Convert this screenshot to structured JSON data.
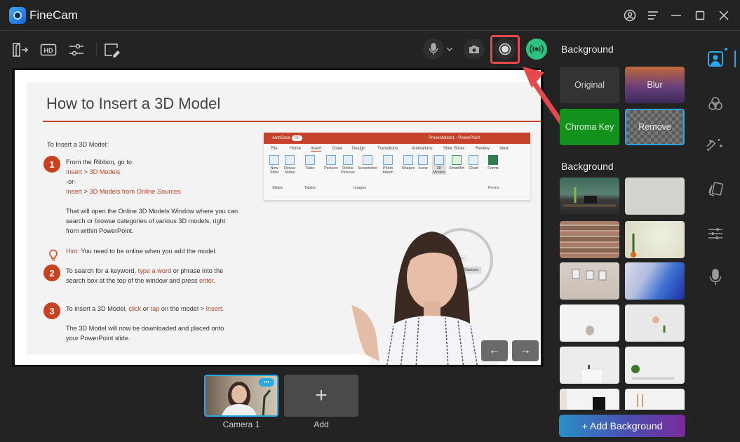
{
  "app": {
    "title": "FineCam"
  },
  "window_controls": [
    "account-icon",
    "menu-icon",
    "minimize-icon",
    "maximize-icon",
    "close-icon"
  ],
  "toolbar": {
    "left_tools": [
      "exit-icon",
      "hd-icon",
      "adjust-icon",
      "annotate-icon"
    ],
    "right_tools": [
      "microphone-icon",
      "chevron-down-icon",
      "camera-snapshot-icon",
      "record-icon",
      "live-broadcast-icon"
    ],
    "live_color": "#2ec27e",
    "highlight_color": "#e5484d"
  },
  "slide": {
    "title": "How to Insert a 3D Model",
    "intro": "To Insert a 3D Model:",
    "steps": [
      {
        "num": "1",
        "lines": [
          "From the Ribbon, go to"
        ],
        "path1": {
          "a": "Insert",
          "sep": " > ",
          "b": "3D Models"
        },
        "or": "-or-",
        "path2": {
          "a": "Insert",
          "sep": " > ",
          "b": "3D Models from Online Sources"
        }
      },
      {
        "num": "2",
        "pre": "To search for a keyword, ",
        "acc1": "type a word",
        "mid": " or phrase into the",
        "line2_pre": "search box at the top of the window and press ",
        "acc2": "enter",
        "end": "."
      },
      {
        "num": "3",
        "pre": "To insert a 3D Model, ",
        "acc1": "click",
        "mid1": " or ",
        "acc2": "tap",
        "mid2": " on the model > ",
        "acc3": "Insert",
        "end": "."
      }
    ],
    "para1": [
      "That will open the Online 3D Models Window where you can",
      "search or browse categories of various 3D models, right",
      "from within PowerPoint."
    ],
    "hint_label": "Hint:",
    "hint_text": " You need to be online when you add the model.",
    "para3": [
      "The 3D Model will now be downloaded and placed onto",
      "your PowerPoint slide."
    ],
    "ribbon": {
      "autosave": "AutoSave",
      "toggle": "On",
      "doc_title": "Presentation1 - PowerPoint",
      "tabs": [
        "File",
        "Home",
        "Insert",
        "Draw",
        "Design",
        "Transitions",
        "Animations",
        "Slide Show",
        "Review",
        "View"
      ],
      "items": [
        "New Slide",
        "Reuse Slides",
        "Table",
        "Pictures",
        "Online Pictures",
        "Screenshot",
        "Photo Album",
        "Shapes",
        "Icons",
        "3D Models",
        "SmartArt",
        "Chart",
        "Forms"
      ],
      "groups": [
        "Slides",
        "Tables",
        "Images",
        "Forms"
      ],
      "menu": [
        "From a File...",
        "From Online Sources"
      ]
    }
  },
  "nav": {
    "prev": "←",
    "next": "→"
  },
  "scenes": [
    {
      "label": "Camera 1",
      "more": "•••"
    }
  ],
  "add_scene": {
    "icon": "+",
    "label": "Add"
  },
  "right_panel": {
    "mode_heading": "Background",
    "modes": [
      {
        "label": "Original",
        "active": false
      },
      {
        "label": "Blur",
        "active": false
      },
      {
        "label": "Chroma Key",
        "active": false
      },
      {
        "label": "Remove",
        "active": true
      }
    ],
    "gallery_heading": "Background",
    "gallery": [
      {
        "name": "office-window-plant"
      },
      {
        "name": "white-plaster-wall"
      },
      {
        "name": "brick-wall"
      },
      {
        "name": "cream-wall-plant"
      },
      {
        "name": "gallery-frames-wall"
      },
      {
        "name": "blue-abstract-paint"
      },
      {
        "name": "white-room-chair"
      },
      {
        "name": "white-wall-clock-plant"
      },
      {
        "name": "white-shelf"
      },
      {
        "name": "white-desk-plants"
      },
      {
        "name": "white-room-sign"
      },
      {
        "name": "white-room-shelf"
      }
    ],
    "add_button": "+ Add Background",
    "accent": "#2aa7e8"
  },
  "side_rail": [
    "background-person-icon",
    "color-filter-icon",
    "magic-wand-icon",
    "stickers-icon",
    "adjustments-icon",
    "microphone-icon"
  ]
}
